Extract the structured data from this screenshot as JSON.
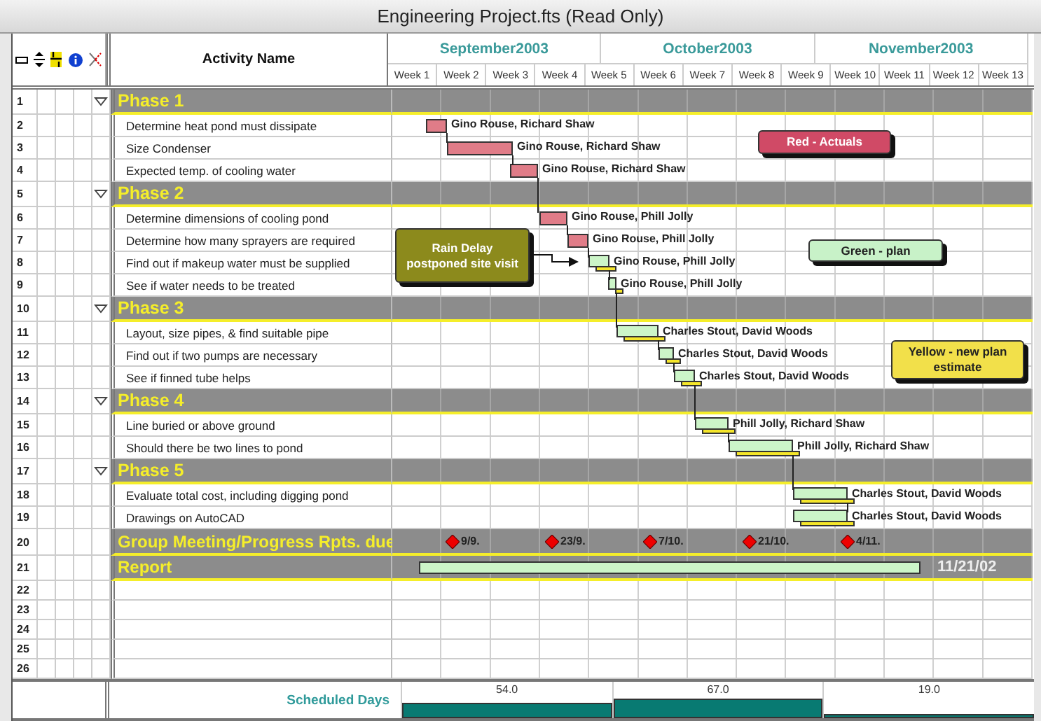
{
  "window": {
    "title": "Engineering Project.fts (Read Only)"
  },
  "header": {
    "activity_column": "Activity Name",
    "months": [
      "September2003",
      "October2003",
      "November2003"
    ],
    "weeks": [
      "Week 1",
      "Week 2",
      "Week 3",
      "Week 4",
      "Week 5",
      "Week 6",
      "Week 7",
      "Week 8",
      "Week 9",
      "Week 10",
      "Week 11",
      "Week 12",
      "Week 13"
    ]
  },
  "rows": [
    {
      "number": "1",
      "kind": "phase",
      "name": "Phase 1",
      "expanded": true
    },
    {
      "number": "2",
      "kind": "task",
      "name": "Determine heat pond must dissipate",
      "resources": "Gino Rouse, Richard Shaw",
      "actual": true
    },
    {
      "number": "3",
      "kind": "task",
      "name": "Size Condenser",
      "resources": "Gino Rouse, Richard Shaw",
      "actual": true
    },
    {
      "number": "4",
      "kind": "task",
      "name": "Expected temp. of cooling water",
      "resources": "Gino Rouse, Richard Shaw",
      "actual": true
    },
    {
      "number": "5",
      "kind": "phase",
      "name": "Phase 2",
      "expanded": true
    },
    {
      "number": "6",
      "kind": "task",
      "name": "Determine dimensions of cooling pond",
      "resources": "Gino Rouse, Phill Jolly",
      "actual": true
    },
    {
      "number": "7",
      "kind": "task",
      "name": "Determine how many sprayers are required",
      "resources": "Gino Rouse, Phill Jolly",
      "actual": true
    },
    {
      "number": "8",
      "kind": "task",
      "name": "Find out if makeup water must be supplied",
      "resources": "Gino Rouse, Phill Jolly",
      "actual": false
    },
    {
      "number": "9",
      "kind": "task",
      "name": "See if water needs to be treated",
      "resources": "Gino Rouse, Phill Jolly",
      "actual": false
    },
    {
      "number": "10",
      "kind": "phase",
      "name": "Phase 3",
      "expanded": true
    },
    {
      "number": "11",
      "kind": "task",
      "name": "Layout, size pipes, & find suitable pipe",
      "resources": "Charles Stout, David Woods",
      "actual": false
    },
    {
      "number": "12",
      "kind": "task",
      "name": "Find out if two pumps are necessary",
      "resources": "Charles Stout, David Woods",
      "actual": false
    },
    {
      "number": "13",
      "kind": "task",
      "name": "See if finned tube helps",
      "resources": "Charles Stout, David Woods",
      "actual": false
    },
    {
      "number": "14",
      "kind": "phase",
      "name": "Phase 4",
      "expanded": true
    },
    {
      "number": "15",
      "kind": "task",
      "name": "Line buried or above ground",
      "resources": "Phill Jolly, Richard Shaw",
      "actual": false
    },
    {
      "number": "16",
      "kind": "task",
      "name": "Should there be two lines to pond",
      "resources": "Phill Jolly, Richard Shaw",
      "actual": false
    },
    {
      "number": "17",
      "kind": "phase",
      "name": "Phase 5",
      "expanded": true
    },
    {
      "number": "18",
      "kind": "task",
      "name": "Evaluate total cost, including digging pond",
      "resources": "Charles Stout, David Woods",
      "actual": false
    },
    {
      "number": "19",
      "kind": "task",
      "name": "Drawings on AutoCAD",
      "resources": "Charles Stout, David Woods",
      "actual": false
    },
    {
      "number": "20",
      "kind": "milestones",
      "name": "Group Meeting/Progress Rpts. due",
      "milestones": [
        "9/9.",
        "23/9.",
        "7/10.",
        "21/10.",
        "4/11."
      ]
    },
    {
      "number": "21",
      "kind": "summary",
      "name": "Report",
      "end_date": "11/21/02"
    },
    {
      "number": "22",
      "kind": "empty"
    },
    {
      "number": "23",
      "kind": "empty"
    },
    {
      "number": "24",
      "kind": "empty"
    },
    {
      "number": "25",
      "kind": "empty"
    },
    {
      "number": "26",
      "kind": "empty"
    }
  ],
  "callouts": [
    {
      "text": "Red - Actuals",
      "color": "#d04a66"
    },
    {
      "text": "Rain Delay postponed site visit",
      "color": "#8c8a1c"
    },
    {
      "text": "Green - plan",
      "color": "#c8f2c8"
    },
    {
      "text": "Yellow - new plan estimate",
      "color": "#f2e04a"
    }
  ],
  "footer": {
    "label": "Scheduled Days",
    "segments": [
      "54.0",
      "67.0",
      "19.0"
    ]
  }
}
